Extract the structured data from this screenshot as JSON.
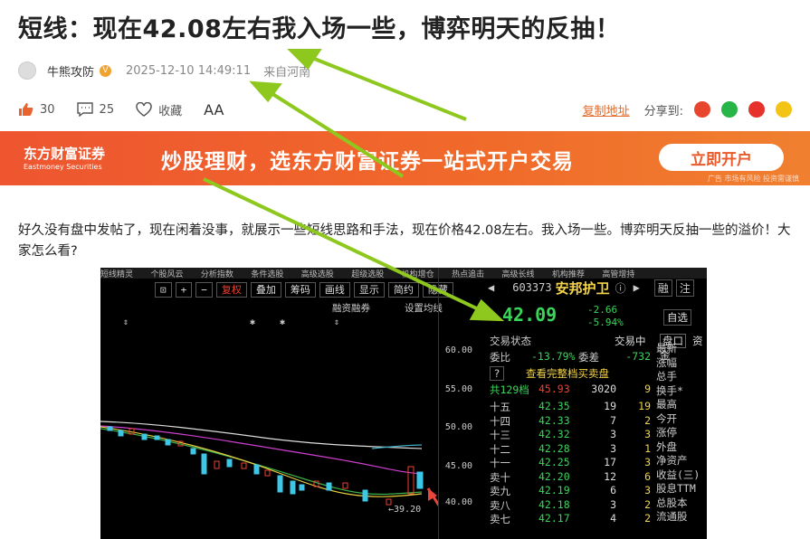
{
  "article": {
    "title": "短线：现在42.08左右我入场一些，博弈明天的反抽！",
    "author": "牛熊攻防",
    "verified_badge": "V",
    "date": "2025-12-10 14:49:11",
    "location": "来自河南",
    "likes": "30",
    "comments": "25",
    "collect": "收藏",
    "font_size": "AA",
    "copy_link": "复制地址",
    "share_to": "分享到:",
    "body": "好久没有盘中发帖了，现在闲着没事，就展示一些短线思路和手法，现在价格42.08左右。我入场一些。博弈明天反抽一些的溢价！大家怎么看?"
  },
  "banner": {
    "brand_cn": "东方财富证券",
    "brand_en": "Eastmoney Securities",
    "slogan": "炒股理财，选东方财富证券一站式开户交易",
    "cta": "立即开户",
    "ad_note": "广告 市场有风险 投资需谨慎"
  },
  "screenshot": {
    "menu": [
      "短线精灵",
      "个股风云",
      "分析指数",
      "条件选股",
      "高级选股",
      "超级选股",
      "机构增仓",
      "热点追击",
      "高级长线",
      "机构推荐",
      "高管增持"
    ],
    "toolbar": [
      "复权",
      "叠加",
      "筹码",
      "画线",
      "显示",
      "简约",
      "隐藏"
    ],
    "sub_labels": [
      "融资融券",
      "设置均线"
    ],
    "y_ticks": [
      "60.00",
      "55.00",
      "50.00",
      "45.00",
      "40.00"
    ],
    "low_label": "39.20",
    "stock_code": "603373",
    "stock_name": "安邦护卫",
    "price": "42.09",
    "change": "-2.66",
    "change_pct": "-5.94%",
    "side_buttons": [
      "融",
      "注"
    ],
    "self_select": "自选",
    "trade_status": "交易状态",
    "trading": "交易中",
    "tab_book": "盘口",
    "tab_capital": "资金",
    "weibi_label": "委比",
    "weibi": "-13.79%",
    "weicha_label": "委差",
    "weicha": "-732",
    "full_book": "查看完整档买卖盘",
    "levels_label": "共129档",
    "levels_price": "45.93",
    "levels_vol": "3020",
    "levels_n": "9",
    "asks": [
      {
        "label": "十五",
        "price": "42.35",
        "vol": "19",
        "n": "19"
      },
      {
        "label": "十四",
        "price": "42.33",
        "vol": "7",
        "n": "2"
      },
      {
        "label": "十三",
        "price": "42.32",
        "vol": "3",
        "n": "3"
      },
      {
        "label": "十二",
        "price": "42.28",
        "vol": "3",
        "n": "1"
      },
      {
        "label": "十一",
        "price": "42.25",
        "vol": "17",
        "n": "3"
      },
      {
        "label": "卖十",
        "price": "42.20",
        "vol": "12",
        "n": "6"
      },
      {
        "label": "卖九",
        "price": "42.19",
        "vol": "6",
        "n": "3"
      },
      {
        "label": "卖八",
        "price": "42.18",
        "vol": "3",
        "n": "2"
      },
      {
        "label": "卖七",
        "price": "42.17",
        "vol": "4",
        "n": "2"
      }
    ],
    "side_labels": [
      "最新",
      "涨幅",
      "总手",
      "换手*",
      "最高",
      "今开",
      "涨停",
      "外盘",
      "净资产",
      "收益(三)",
      "股息TTM",
      "总股本",
      "流通股"
    ]
  }
}
